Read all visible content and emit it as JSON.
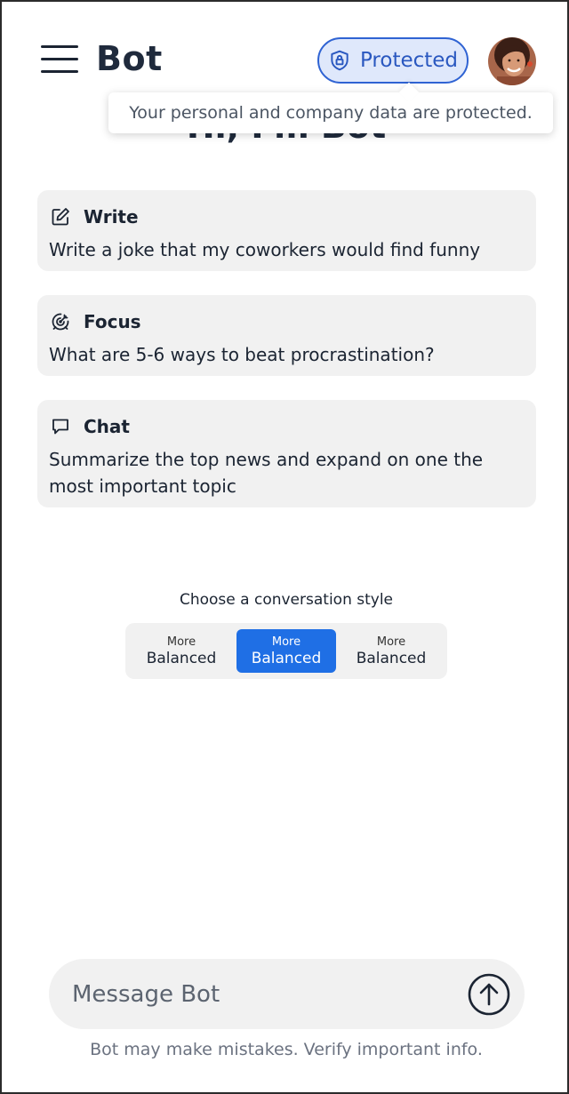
{
  "header": {
    "app_title": "Bot",
    "protected_label": "Protected",
    "tooltip": "Your personal and company data are protected."
  },
  "greeting": "Hi, I'm Bot",
  "cards": [
    {
      "icon": "edit-icon",
      "title": "Write",
      "body": "Write a joke that my coworkers would find funny"
    },
    {
      "icon": "target-icon",
      "title": "Focus",
      "body": "What are 5-6 ways to beat procrastination?"
    },
    {
      "icon": "chat-bubble-icon",
      "title": "Chat",
      "body": "Summarize the top news and expand on one the most important topic"
    }
  ],
  "conversation_style": {
    "caption": "Choose a conversation style",
    "options": [
      {
        "small": "More",
        "big": "Balanced",
        "selected": false
      },
      {
        "small": "More",
        "big": "Balanced",
        "selected": true
      },
      {
        "small": "More",
        "big": "Balanced",
        "selected": false
      }
    ]
  },
  "composer": {
    "placeholder": "Message Bot",
    "disclaimer": "Bot may make mistakes. Verify important info."
  },
  "colors": {
    "accent": "#1f6fe5",
    "protected_border": "#2f63d3",
    "protected_bg": "#dfe8fb",
    "card_bg": "#f1f1f1"
  }
}
